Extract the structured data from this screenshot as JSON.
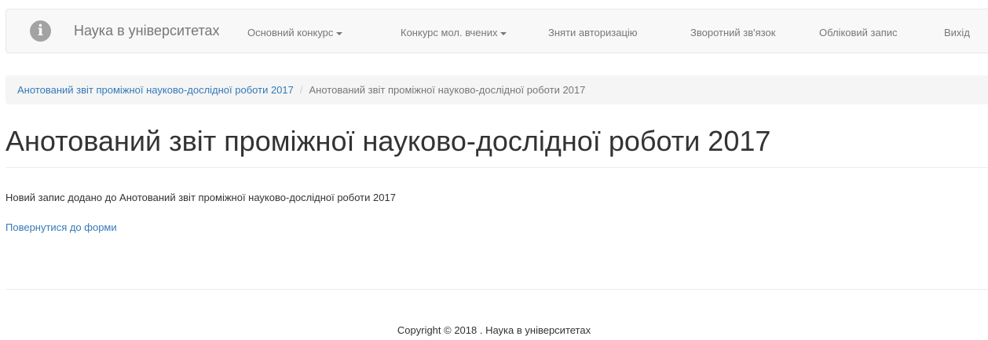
{
  "navbar": {
    "logo_glyph": "i",
    "brand": "Наука в університетах",
    "items": [
      {
        "label": "Основний конкурс",
        "dropdown": true
      },
      {
        "label": "Конкурс мол. вчених",
        "dropdown": true
      },
      {
        "label": "Зняти авторизацію",
        "dropdown": false
      },
      {
        "label": "Зворотний зв'язок",
        "dropdown": false
      },
      {
        "label": "Обліковий запис",
        "dropdown": false
      },
      {
        "label": "Вихід",
        "dropdown": false
      }
    ]
  },
  "breadcrumb": {
    "link": "Анотований звіт проміжної науково-дослідної роботи 2017",
    "separator": "/",
    "current": "Анотований звіт проміжної науково-дослідної роботи 2017"
  },
  "main": {
    "title": "Анотований звіт проміжної науково-дослідної роботи 2017",
    "message": "Новий запис додано до Анотований звіт проміжної науково-дослідної роботи 2017",
    "back_link": "Повернутися до форми"
  },
  "footer": {
    "copyright": "Copyright © 2018 . Наука в університетах"
  },
  "colors": {
    "link": "#337ab7",
    "nav_text": "#777777",
    "navbar_bg": "#f8f8f8",
    "breadcrumb_bg": "#f5f5f5"
  }
}
